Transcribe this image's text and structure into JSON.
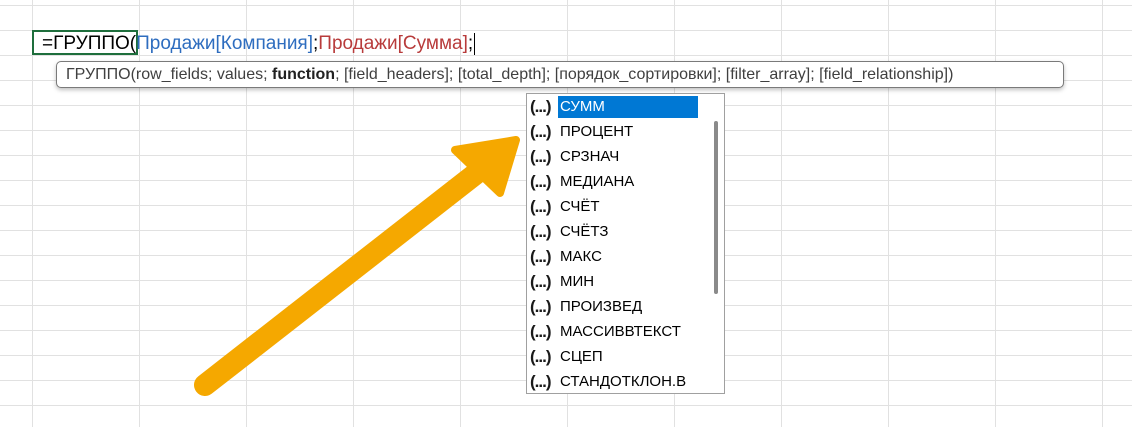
{
  "formula": {
    "prefix": "=ГРУППО(",
    "arg1": "Продажи[Компания]",
    "sep1": ";",
    "arg2": "Продажи[Сумма]",
    "sep2": ";"
  },
  "tooltip": {
    "fn_name": "ГРУППО(",
    "before_bold": "row_fields; values; ",
    "bold_arg": "function",
    "after_bold": "; [field_headers]; [total_depth]; [порядок_сортировки]; [filter_array]; [field_relationship])"
  },
  "autocomplete": {
    "icon_glyph": "(...)",
    "items": [
      {
        "label": "СУММ"
      },
      {
        "label": "ПРОЦЕНТ"
      },
      {
        "label": "СРЗНАЧ"
      },
      {
        "label": "МЕДИАНА"
      },
      {
        "label": "СЧЁТ"
      },
      {
        "label": "СЧЁТЗ"
      },
      {
        "label": "МАКС"
      },
      {
        "label": "МИН"
      },
      {
        "label": "ПРОИЗВЕД"
      },
      {
        "label": "МАССИВВТЕКСТ"
      },
      {
        "label": "СЦЕП"
      },
      {
        "label": "СТАНДОТКЛОН.В"
      }
    ]
  },
  "colors": {
    "accent": "#0078d4",
    "arrow": "#f5a800",
    "ref_blue": "#2e6dbf",
    "ref_red": "#b83b3b"
  }
}
